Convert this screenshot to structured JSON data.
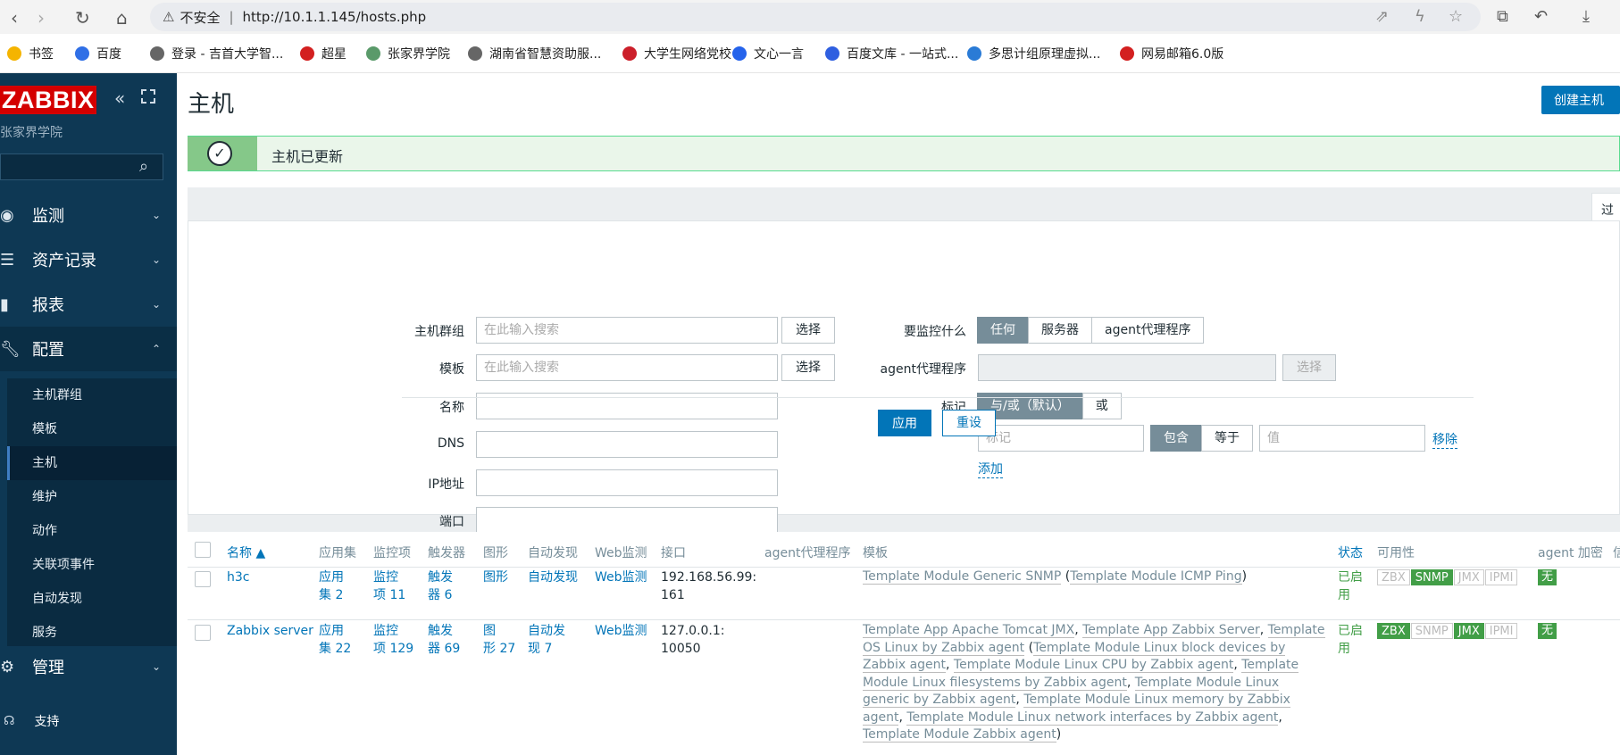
{
  "browser": {
    "security": "不安全",
    "url": "http://10.1.1.145/hosts.php"
  },
  "bookmarks": [
    {
      "label": "书签",
      "color": "#f5b400"
    },
    {
      "label": "百度",
      "color": "#2f6fe6"
    },
    {
      "label": "登录 - 吉首大学智...",
      "color": "#666"
    },
    {
      "label": "超星",
      "color": "#d32020"
    },
    {
      "label": "张家界学院",
      "color": "#5a9a6a"
    },
    {
      "label": "湖南省智慧资助服...",
      "color": "#666"
    },
    {
      "label": "大学生网络党校",
      "color": "#cc1f2a"
    },
    {
      "label": "文心一言",
      "color": "#2563eb"
    },
    {
      "label": "百度文库 - 一站式...",
      "color": "#2f5fe0"
    },
    {
      "label": "多思计组原理虚拟...",
      "color": "#2a7bd6"
    },
    {
      "label": "网易邮箱6.0版",
      "color": "#d32020"
    }
  ],
  "sidebar": {
    "logo": "ZABBIX",
    "server_name": "张家界学院",
    "menu": [
      {
        "label": "监测"
      },
      {
        "label": "资产记录"
      },
      {
        "label": "报表"
      },
      {
        "label": "配置"
      },
      {
        "label": "管理"
      }
    ],
    "submenu": [
      {
        "label": "主机群组"
      },
      {
        "label": "模板"
      },
      {
        "label": "主机"
      },
      {
        "label": "维护"
      },
      {
        "label": "动作"
      },
      {
        "label": "关联项事件"
      },
      {
        "label": "自动发现"
      },
      {
        "label": "服务"
      }
    ],
    "support": "支持"
  },
  "page": {
    "title": "主机",
    "create_button": "创建主机",
    "message": "主机已更新",
    "filter_tab": "过"
  },
  "filter": {
    "host_groups_label": "主机群组",
    "templates_label": "模板",
    "name_label": "名称",
    "dns_label": "DNS",
    "ip_label": "IP地址",
    "port_label": "端口",
    "search_placeholder": "在此输入搜索",
    "select_button": "选择",
    "monitored_by_label": "要监控什么",
    "monitored_by_options": [
      "任何",
      "服务器",
      "agent代理程序"
    ],
    "proxy_label": "agent代理程序",
    "proxy_select": "选择",
    "tags_label": "标记",
    "tags_mode_options": [
      "与/或（默认）",
      "或"
    ],
    "tag_placeholder": "标记",
    "tag_op_options": [
      "包含",
      "等于"
    ],
    "value_placeholder": "值",
    "remove_link": "移除",
    "add_link": "添加",
    "apply_button": "应用",
    "reset_button": "重设"
  },
  "table": {
    "headers": [
      "名称 ▲",
      "应用集",
      "监控项",
      "触发器",
      "图形",
      "自动发现",
      "Web监测",
      "接口",
      "agent代理程序",
      "模板",
      "状态",
      "可用性",
      "agent 加密",
      "信"
    ],
    "rows": [
      {
        "name": "h3c",
        "apps": [
          "应用",
          "集 2"
        ],
        "items": [
          "监控",
          "项 11"
        ],
        "triggers": [
          "触发",
          "器 6"
        ],
        "graphs": [
          "图形"
        ],
        "discovery": [
          "自动发现"
        ],
        "web": "Web监测",
        "iface": [
          "192.168.56.99:",
          "161"
        ],
        "templates": "<span class='tpl'>Template Module Generic SNMP</span> (<span class='tpl'>Template Module ICMP Ping</span>)",
        "status": [
          "已启",
          "用"
        ],
        "avail": [
          {
            "l": "ZBX",
            "on": false
          },
          {
            "l": "SNMP",
            "on": true
          },
          {
            "l": "JMX",
            "on": false
          },
          {
            "l": "IPMI",
            "on": false
          }
        ],
        "enc": "无"
      },
      {
        "name": "Zabbix server",
        "apps": [
          "应用",
          "集 22"
        ],
        "items": [
          "监控",
          "项 129"
        ],
        "triggers": [
          "触发",
          "器 69"
        ],
        "graphs": [
          "图",
          "形 27"
        ],
        "discovery": [
          "自动发",
          "现 7"
        ],
        "web": "Web监测",
        "iface": [
          "127.0.0.1:",
          "10050"
        ],
        "templates": "<span class='tpl'>Template App Apache Tomcat JMX</span>, <span class='tpl'>Template App Zabbix Server</span>, <span class='tpl'>Template OS Linux by Zabbix agent</span> (<span class='tpl'>Template Module Linux block devices by Zabbix agent</span>, <span class='tpl'>Template Module Linux CPU by Zabbix agent</span>, <span class='tpl'>Template Module Linux filesystems by Zabbix agent</span>, <span class='tpl'>Template Module Linux generic by Zabbix agent</span>, <span class='tpl'>Template Module Linux memory by Zabbix agent</span>, <span class='tpl'>Template Module Linux network interfaces by Zabbix agent</span>, <span class='tpl'>Template Module Zabbix agent</span>)",
        "status": [
          "已启",
          "用"
        ],
        "avail": [
          {
            "l": "ZBX",
            "on": true
          },
          {
            "l": "SNMP",
            "on": false
          },
          {
            "l": "JMX",
            "on": true
          },
          {
            "l": "IPMI",
            "on": false
          }
        ],
        "enc": "无"
      }
    ]
  }
}
